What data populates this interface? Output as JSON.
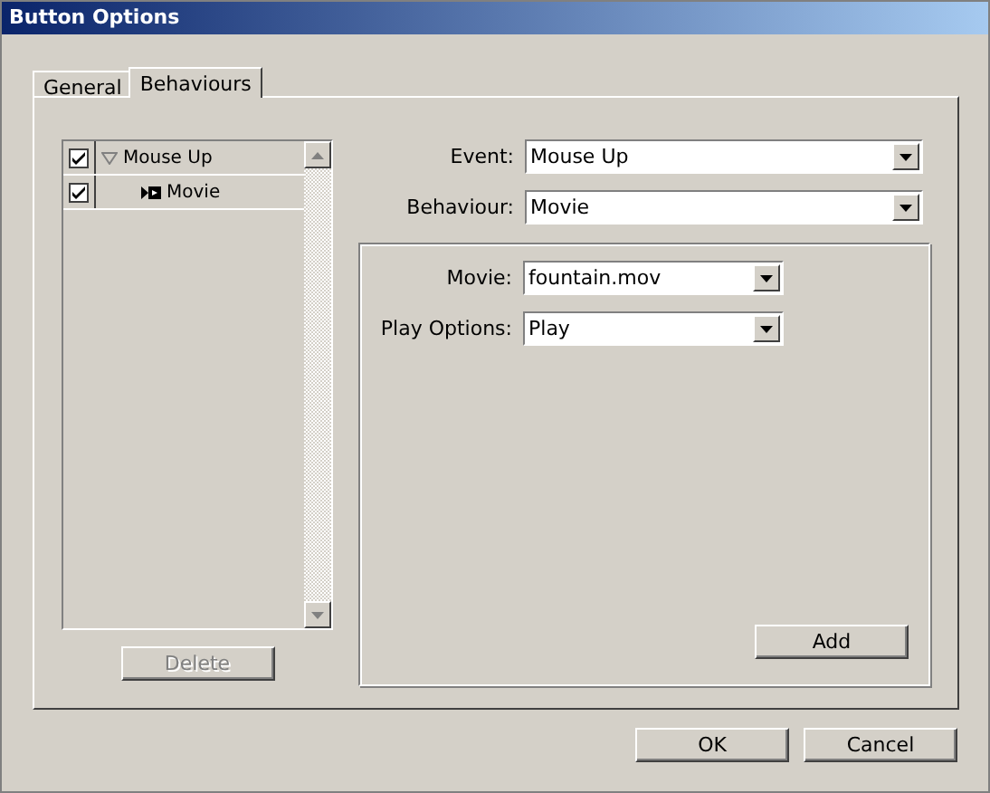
{
  "window": {
    "title": "Button Options"
  },
  "tabs": [
    {
      "label": "General",
      "selected": false
    },
    {
      "label": "Behaviours",
      "selected": true
    }
  ],
  "behaviour_tree": {
    "items": [
      {
        "label": "Mouse Up",
        "checked": true,
        "expanded": true,
        "children": [
          {
            "label": "Movie",
            "checked": true
          }
        ]
      }
    ]
  },
  "delete_button": {
    "label": "Delete",
    "disabled": true
  },
  "fields": [
    {
      "label": "Event:",
      "value": "Mouse Up"
    },
    {
      "label": "Behaviour:",
      "value": "Movie"
    }
  ],
  "group_fields": [
    {
      "label": "Movie:",
      "value": "fountain.mov"
    },
    {
      "label": "Play Options:",
      "value": "Play"
    }
  ],
  "add_button": {
    "label": "Add",
    "disabled": false
  },
  "buttons": [
    "OK",
    "Cancel"
  ]
}
